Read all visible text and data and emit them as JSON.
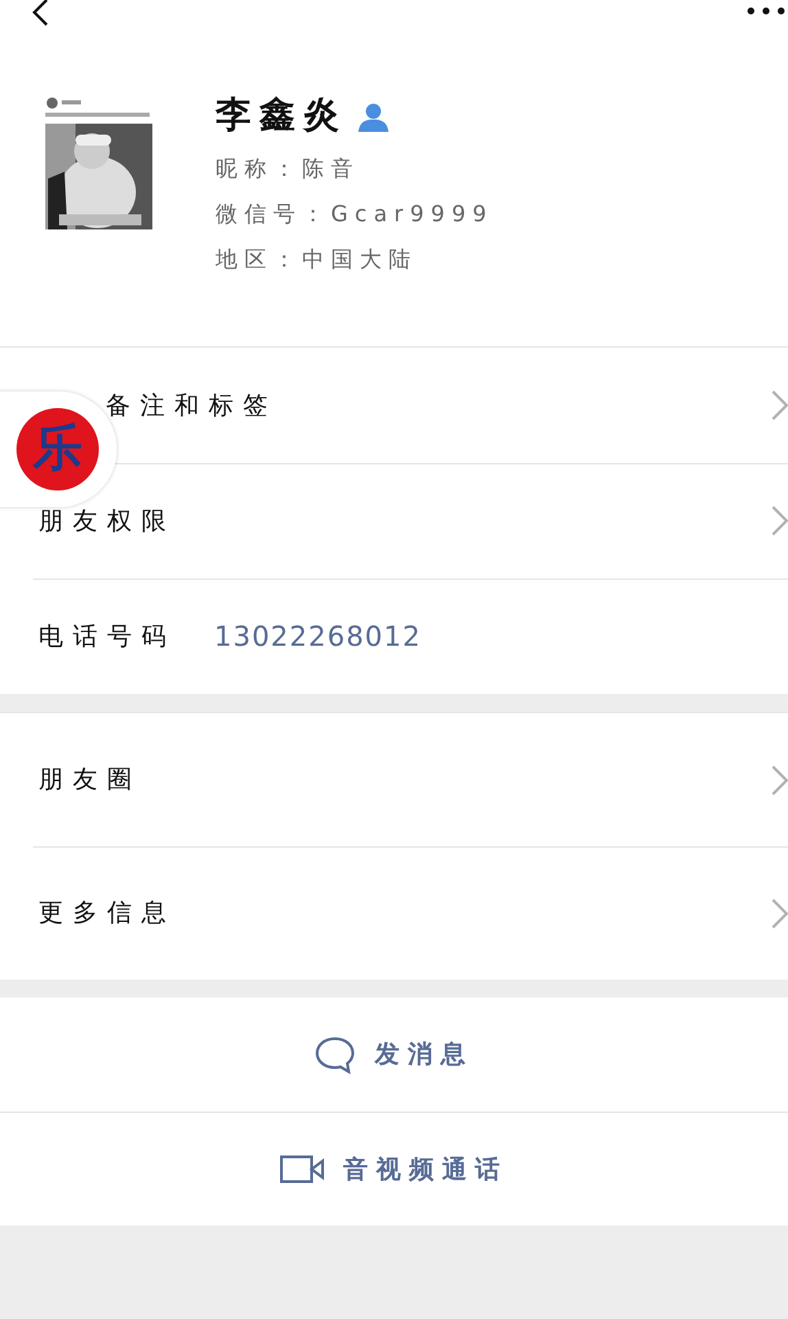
{
  "profile": {
    "name": "李鑫炎",
    "details": [
      {
        "label": "昵称：",
        "value": "陈音"
      },
      {
        "label": "微信号：",
        "value": "Gcar9999"
      },
      {
        "label": "地区：",
        "value": "中国大陆"
      }
    ]
  },
  "sections": [
    {
      "rows": [
        {
          "kind": "covered",
          "label": "备注和标签"
        },
        {
          "kind": "link",
          "label": "朋友权限"
        },
        {
          "kind": "phone",
          "label": "电话号码",
          "value": "13022268012"
        }
      ]
    },
    {
      "rows": [
        {
          "kind": "link",
          "label": "朋友圈"
        },
        {
          "kind": "link",
          "label": "更多信息"
        }
      ]
    }
  ],
  "actions": [
    {
      "kind": "message",
      "label": "发消息"
    },
    {
      "kind": "video",
      "label": "音视频通话"
    }
  ],
  "floating_button": {
    "label": "乐"
  }
}
